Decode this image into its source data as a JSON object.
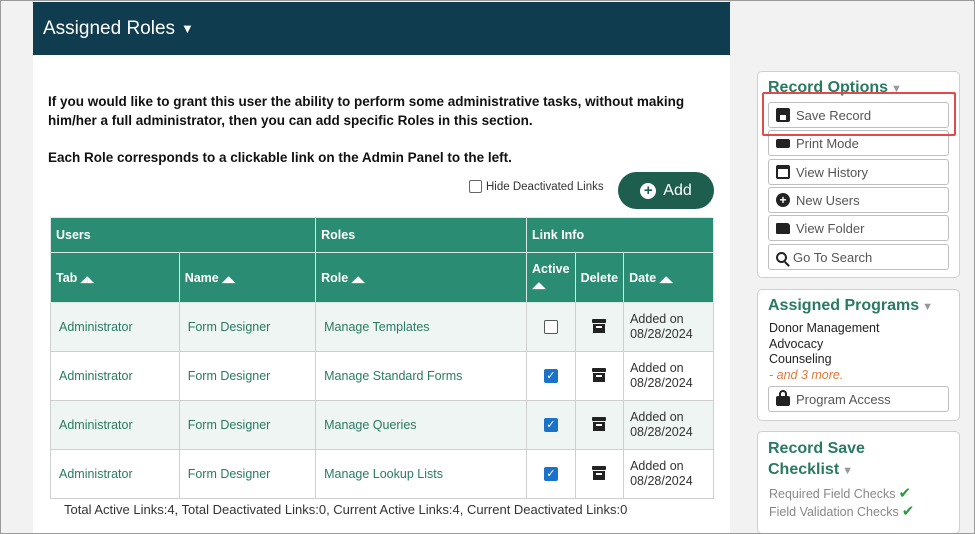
{
  "main": {
    "title": "Assigned Roles",
    "caret": "▼",
    "intro1": "If you would like to grant this user the ability to perform some administrative tasks, without making him/her a full administrator, then you can add specific Roles in this section.",
    "intro2": "Each Role corresponds to a clickable link on the Admin Panel to the left.",
    "hide_label": "Hide Deactivated Links",
    "add_label": "Add",
    "add_icon": "+",
    "table": {
      "groups": [
        "Users",
        "Roles",
        "Link Info"
      ],
      "columns": [
        "Tab",
        "Name",
        "Role",
        "Active",
        "Delete",
        "Date"
      ],
      "sort_icon": "◢◣",
      "rows": [
        {
          "tab": "Administrator",
          "name": "Form Designer",
          "role": "Manage Templates",
          "active": false,
          "date1": "Added on",
          "date2": "08/28/2024"
        },
        {
          "tab": "Administrator",
          "name": "Form Designer",
          "role": "Manage Standard Forms",
          "active": true,
          "date1": "Added on",
          "date2": "08/28/2024"
        },
        {
          "tab": "Administrator",
          "name": "Form Designer",
          "role": "Manage Queries",
          "active": true,
          "date1": "Added on",
          "date2": "08/28/2024"
        },
        {
          "tab": "Administrator",
          "name": "Form Designer",
          "role": "Manage Lookup Lists",
          "active": true,
          "date1": "Added on",
          "date2": "08/28/2024"
        }
      ],
      "check_mark": "✓"
    },
    "totals": "Total Active Links:4, Total Deactivated Links:0, Current Active Links:4, Current Deactivated Links:0"
  },
  "sidebar": {
    "record_options": {
      "title": "Record Options",
      "caret": "▼",
      "buttons": [
        {
          "label": "Save Record",
          "icon": "floppy-disk-icon"
        },
        {
          "label": "Print Mode",
          "icon": "printer-icon"
        },
        {
          "label": "View History",
          "icon": "calendar-icon"
        },
        {
          "label": "New Users",
          "icon": "plus-circle-icon"
        },
        {
          "label": "View Folder",
          "icon": "folder-icon"
        },
        {
          "label": "Go To Search",
          "icon": "search-icon"
        }
      ]
    },
    "assigned_programs": {
      "title": "Assigned Programs",
      "caret": "▼",
      "programs": [
        "Donor Management",
        "Advocacy",
        "Counseling"
      ],
      "more": "- and 3 more.",
      "access_button": "Program Access"
    },
    "checklist": {
      "title_line1": "Record Save",
      "title_line2": "Checklist",
      "caret": "▼",
      "items": [
        "Required Field Checks",
        "Field Validation Checks"
      ],
      "tick": "✔"
    }
  },
  "colors": {
    "header": "#0f3c4e",
    "table_header": "#2a8c72",
    "accent": "#2a7a62",
    "highlight": "#e04a4a",
    "checkbox_on": "#1a73c9"
  }
}
